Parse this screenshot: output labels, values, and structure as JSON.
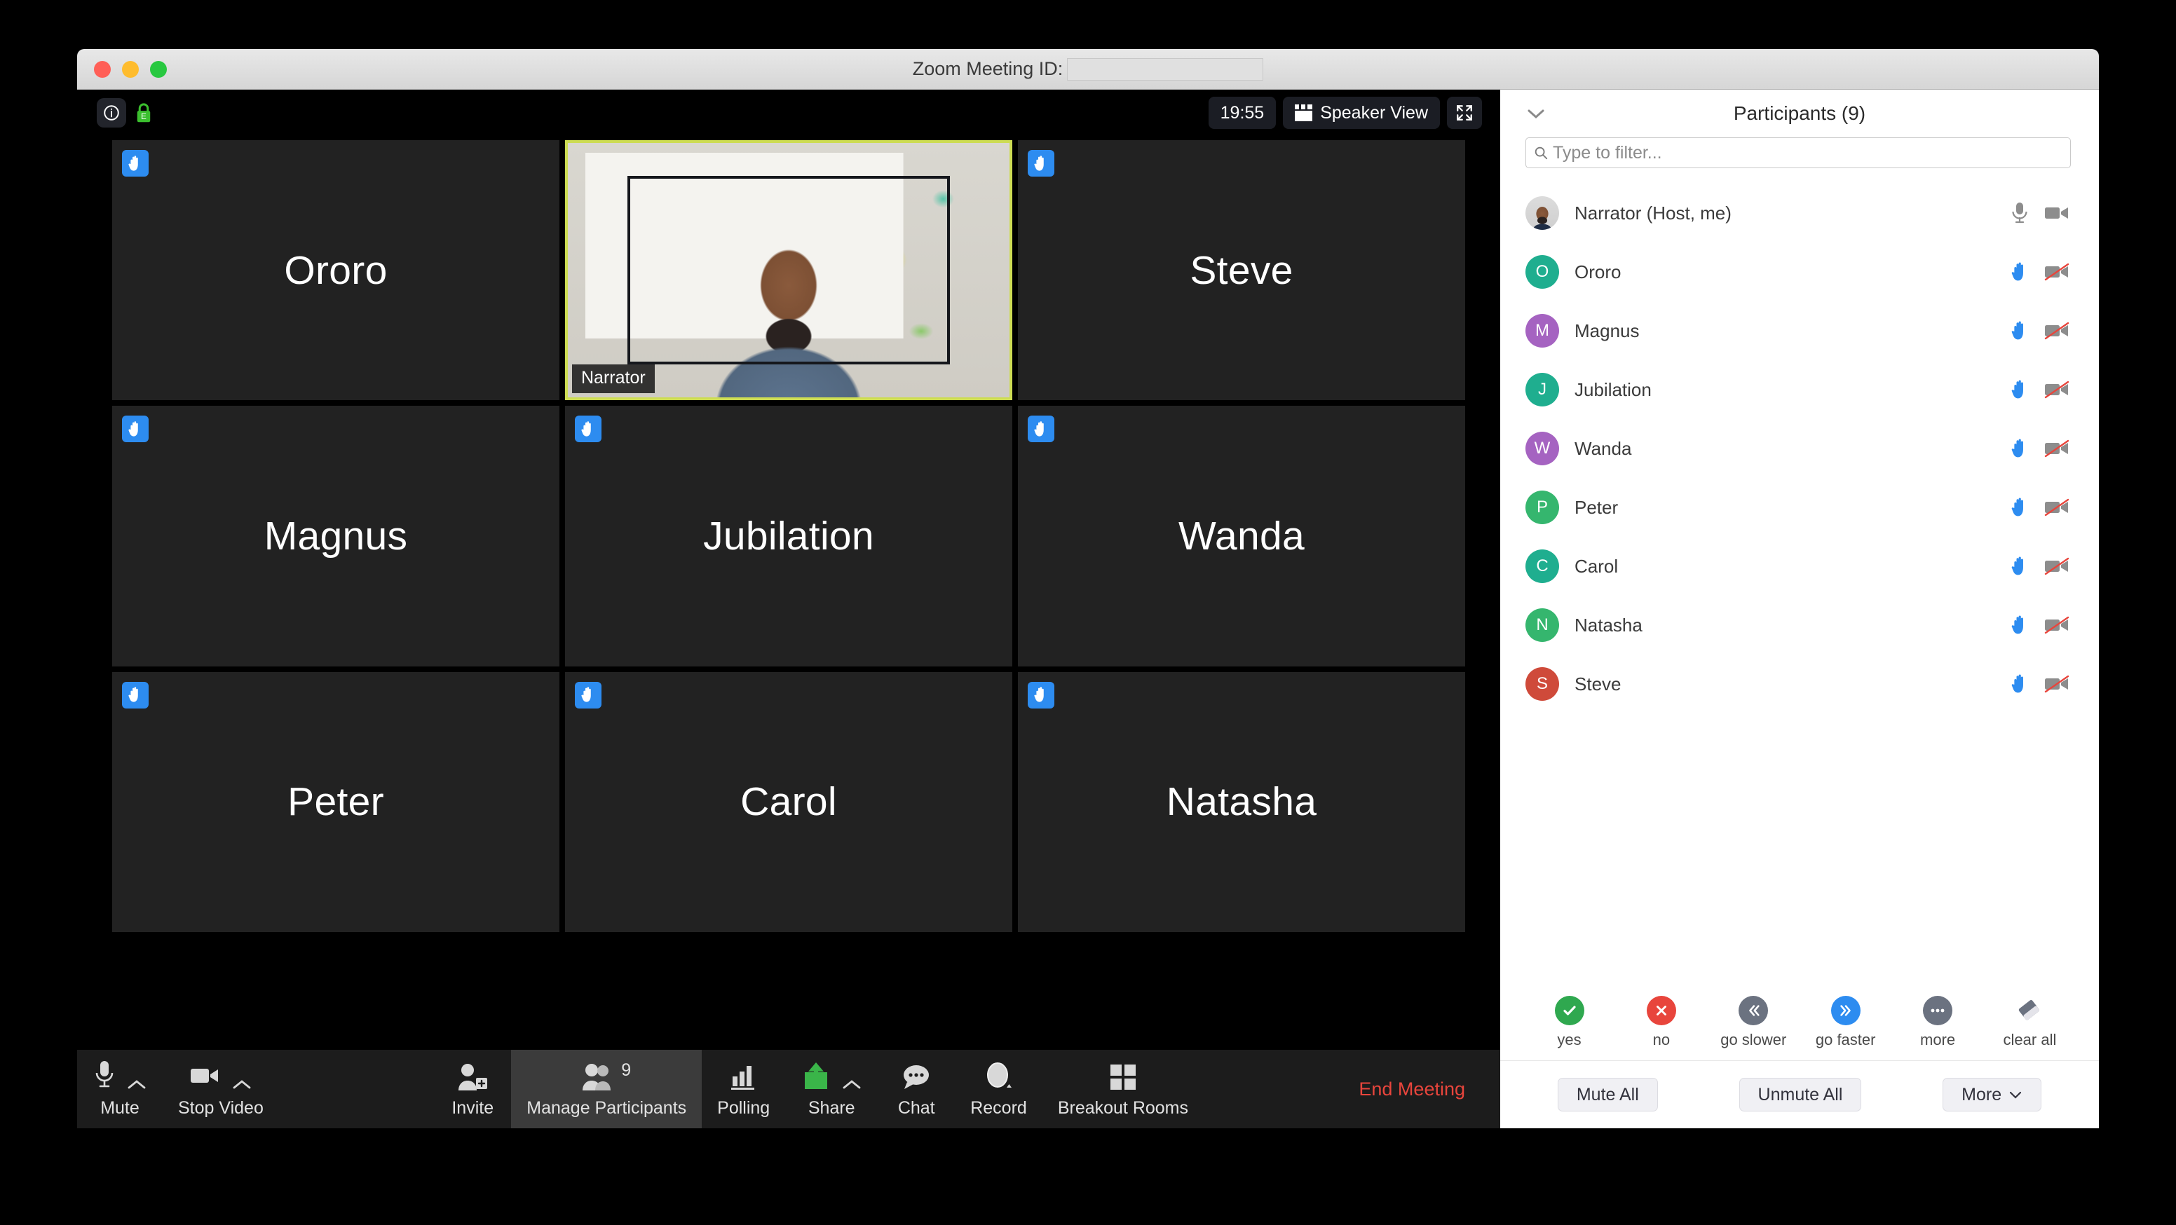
{
  "window": {
    "title": "Zoom Meeting ID:",
    "meeting_id_value": "",
    "traffic_lights": [
      "close",
      "minimize",
      "maximize"
    ]
  },
  "video_topbar": {
    "info_icon": "info-icon",
    "lock_icon": "encryption-lock-icon",
    "timer": "19:55",
    "view_button": "Speaker View",
    "view_icon": "calendar-view-icon",
    "fullscreen_icon": "enter-fullscreen-icon"
  },
  "grid": {
    "tiles": [
      {
        "name": "Ororo",
        "hand_raised": true,
        "video_on": false,
        "active_speaker": false
      },
      {
        "name": "Narrator",
        "hand_raised": false,
        "video_on": true,
        "active_speaker": true
      },
      {
        "name": "Steve",
        "hand_raised": true,
        "video_on": false,
        "active_speaker": false
      },
      {
        "name": "Magnus",
        "hand_raised": true,
        "video_on": false,
        "active_speaker": false
      },
      {
        "name": "Jubilation",
        "hand_raised": true,
        "video_on": false,
        "active_speaker": false
      },
      {
        "name": "Wanda",
        "hand_raised": true,
        "video_on": false,
        "active_speaker": false
      },
      {
        "name": "Peter",
        "hand_raised": true,
        "video_on": false,
        "active_speaker": false
      },
      {
        "name": "Carol",
        "hand_raised": true,
        "video_on": false,
        "active_speaker": false
      },
      {
        "name": "Natasha",
        "hand_raised": true,
        "video_on": false,
        "active_speaker": false
      }
    ]
  },
  "toolbar": {
    "mute_label": "Mute",
    "stop_video_label": "Stop Video",
    "invite_label": "Invite",
    "manage_participants_label": "Manage Participants",
    "participants_count": "9",
    "polling_label": "Polling",
    "share_label": "Share",
    "chat_label": "Chat",
    "record_label": "Record",
    "breakout_label": "Breakout Rooms",
    "end_meeting_label": "End Meeting",
    "share_color": "#3ab549",
    "end_color": "#e8453c"
  },
  "panel": {
    "title": "Participants (9)",
    "collapse_icon": "chevron-down-icon",
    "filter_placeholder": "Type to filter...",
    "filter_value": "",
    "participants": [
      {
        "name": "Narrator (Host, me)",
        "initial": "",
        "avatar_color": "#d0d0d0",
        "photo": true,
        "hand_raised": false,
        "mic": "mic-on",
        "video": "video-on"
      },
      {
        "name": "Ororo",
        "initial": "O",
        "avatar_color": "#1fae8f",
        "photo": false,
        "hand_raised": true,
        "mic": "hand",
        "video": "video-off"
      },
      {
        "name": "Magnus",
        "initial": "M",
        "avatar_color": "#a563c1",
        "photo": false,
        "hand_raised": true,
        "mic": "hand",
        "video": "video-off"
      },
      {
        "name": "Jubilation",
        "initial": "J",
        "avatar_color": "#1fae8f",
        "photo": false,
        "hand_raised": true,
        "mic": "hand",
        "video": "video-off"
      },
      {
        "name": "Wanda",
        "initial": "W",
        "avatar_color": "#a563c1",
        "photo": false,
        "hand_raised": true,
        "mic": "hand",
        "video": "video-off"
      },
      {
        "name": "Peter",
        "initial": "P",
        "avatar_color": "#35b66e",
        "photo": false,
        "hand_raised": true,
        "mic": "hand",
        "video": "video-off"
      },
      {
        "name": "Carol",
        "initial": "C",
        "avatar_color": "#1fae8f",
        "photo": false,
        "hand_raised": true,
        "mic": "hand",
        "video": "video-off"
      },
      {
        "name": "Natasha",
        "initial": "N",
        "avatar_color": "#35b66e",
        "photo": false,
        "hand_raised": true,
        "mic": "hand",
        "video": "video-off"
      },
      {
        "name": "Steve",
        "initial": "S",
        "avatar_color": "#cf4a3a",
        "photo": false,
        "hand_raised": true,
        "mic": "hand",
        "video": "video-off"
      }
    ],
    "reactions": [
      {
        "label": "yes",
        "icon": "check-icon",
        "color": "#2fa84f"
      },
      {
        "label": "no",
        "icon": "cross-icon",
        "color": "#e8453c"
      },
      {
        "label": "go slower",
        "icon": "double-chevron-left-icon",
        "color": "#6b7280"
      },
      {
        "label": "go faster",
        "icon": "double-chevron-right-icon",
        "color": "#2d8cf0"
      },
      {
        "label": "more",
        "icon": "ellipsis-icon",
        "color": "#6b7280"
      },
      {
        "label": "clear all",
        "icon": "eraser-icon",
        "color": "#6b7280"
      }
    ],
    "footer": {
      "mute_all": "Mute All",
      "unmute_all": "Unmute All",
      "more": "More"
    }
  },
  "colors": {
    "hand_blue": "#2d8cf0",
    "active_speaker_border": "#cddc53",
    "tile_bg": "#222222",
    "panel_bg": "#ffffff"
  }
}
